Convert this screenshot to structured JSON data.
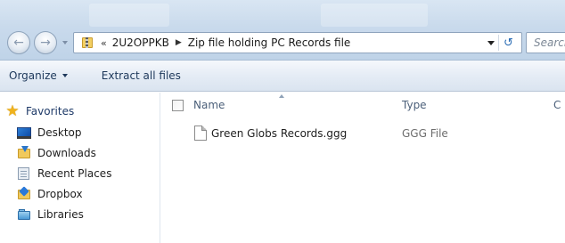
{
  "address_bar": {
    "overflow_chevron": "«",
    "crumbs": [
      "2U2OPPKB",
      "Zip file holding PC Records file"
    ],
    "separator": "▶"
  },
  "search": {
    "placeholder": "Search"
  },
  "toolbar": {
    "organize_label": "Organize",
    "extract_label": "Extract all files"
  },
  "navigation": {
    "favorites_label": "Favorites",
    "items": [
      {
        "label": "Desktop",
        "icon": "desktop-icon"
      },
      {
        "label": "Downloads",
        "icon": "downloads-folder-icon"
      },
      {
        "label": "Recent Places",
        "icon": "recent-places-icon"
      },
      {
        "label": "Dropbox",
        "icon": "dropbox-folder-icon"
      },
      {
        "label": "Libraries",
        "icon": "libraries-icon"
      }
    ]
  },
  "file_list": {
    "columns": [
      "Name",
      "Type",
      "C"
    ],
    "rows": [
      {
        "name": "Green Globs Records.ggg",
        "type": "GGG File"
      }
    ]
  },
  "colors": {
    "chrome_blue": "#c9daec",
    "command_text": "#1e395b",
    "header_text": "#4c607a",
    "favorites_star": "#f0b21c"
  }
}
